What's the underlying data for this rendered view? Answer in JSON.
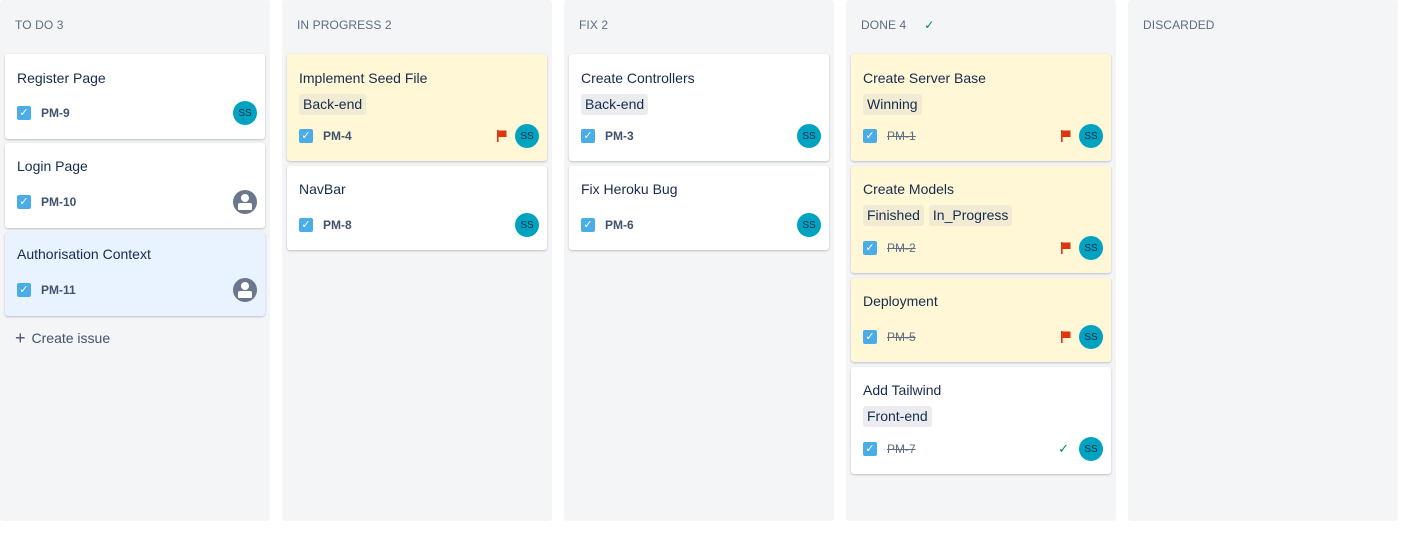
{
  "columns": {
    "todo": {
      "name": "TO DO 3"
    },
    "inprogress": {
      "name": "IN PROGRESS 2"
    },
    "fix": {
      "name": "FIX 2"
    },
    "done": {
      "name": "DONE 4"
    },
    "discarded": {
      "name": "DISCARDED"
    }
  },
  "cards": {
    "pm9": {
      "title": "Register Page",
      "key": "PM-9",
      "avatar": "SS"
    },
    "pm10": {
      "title": "Login Page",
      "key": "PM-10"
    },
    "pm11": {
      "title": "Authorisation Context",
      "key": "PM-11"
    },
    "pm4": {
      "title": "Implement Seed File",
      "label": "Back-end",
      "key": "PM-4",
      "avatar": "SS"
    },
    "pm8": {
      "title": "NavBar",
      "key": "PM-8",
      "avatar": "SS"
    },
    "pm3": {
      "title": "Create Controllers",
      "label": "Back-end",
      "key": "PM-3",
      "avatar": "SS"
    },
    "pm6": {
      "title": "Fix Heroku Bug",
      "key": "PM-6",
      "avatar": "SS"
    },
    "pm1": {
      "title": "Create Server Base",
      "label": "Winning",
      "key": "PM-1",
      "avatar": "SS"
    },
    "pm2": {
      "title": "Create Models",
      "labels": [
        "Finished",
        "In_Progress"
      ],
      "key": "PM-2",
      "avatar": "SS"
    },
    "pm5": {
      "title": "Deployment",
      "key": "PM-5",
      "avatar": "SS"
    },
    "pm7": {
      "title": "Add Tailwind",
      "label": "Front-end",
      "key": "PM-7",
      "avatar": "SS"
    }
  },
  "create_issue": {
    "label": "Create issue"
  },
  "icons": {
    "task": "checkbox-icon",
    "flag": "flag-icon",
    "done": "check-icon",
    "add": "plus-icon",
    "unassigned": "person-icon"
  },
  "colors": {
    "column_bg": "#f4f5f7",
    "flagged_card": "#fff7d6",
    "selected_card": "#e9f2ff",
    "task_icon": "#4bade8",
    "avatar": "#00a3bf",
    "flag": "#de350b",
    "done_check": "#00875a"
  }
}
